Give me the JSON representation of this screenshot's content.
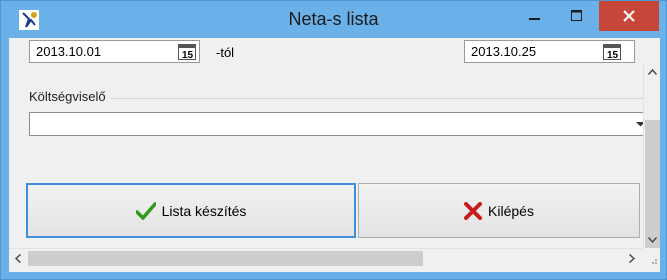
{
  "window": {
    "title": "Neta-s lista"
  },
  "date_from": {
    "value": "2013.10.01",
    "suffix": "-tól",
    "calendar_glyph": "15"
  },
  "date_to": {
    "value": "2013.10.25",
    "calendar_glyph": "15"
  },
  "group": {
    "label": "Költségviselő"
  },
  "combo": {
    "value": ""
  },
  "buttons": {
    "lista_label": "Lista készítés",
    "kilepes_label": "Kilépés"
  },
  "colors": {
    "titlebar": "#6ab0e9",
    "close_button": "#c7463a",
    "check_icon": "#2f9a1b",
    "x_icon": "#c81b1b"
  }
}
